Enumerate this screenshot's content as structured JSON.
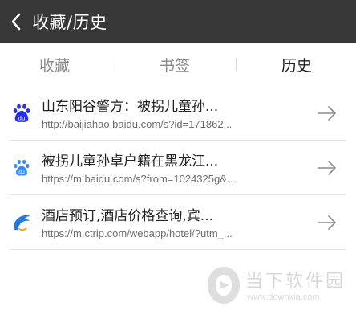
{
  "header": {
    "title": "收藏/历史",
    "back_icon": "chevron-left-icon"
  },
  "tabs": [
    {
      "label": "收藏",
      "active": false
    },
    {
      "label": "书签",
      "active": false
    },
    {
      "label": "历史",
      "active": true
    }
  ],
  "history": [
    {
      "icon": "baidu-du-icon",
      "title": "山东阳谷警方：被拐儿童孙...",
      "url": "http://baijiahao.baidu.com/s?id=171862..."
    },
    {
      "icon": "baidu-paw-icon",
      "title": "被拐儿童孙卓户籍在黑龙江...",
      "url": "https://m.baidu.com/s?from=1024325g&..."
    },
    {
      "icon": "ctrip-dolphin-icon",
      "title": "酒店预订,酒店价格查询,宾...",
      "url": "https://m.ctrip.com/webapp/hotel/?utm_..."
    }
  ],
  "watermark": {
    "brand": "当下软件园",
    "url": "www.downxia.com"
  },
  "colors": {
    "header_bg": "#383838",
    "baidu_blue": "#2932E1",
    "ctrip_blue": "#2577E3"
  }
}
